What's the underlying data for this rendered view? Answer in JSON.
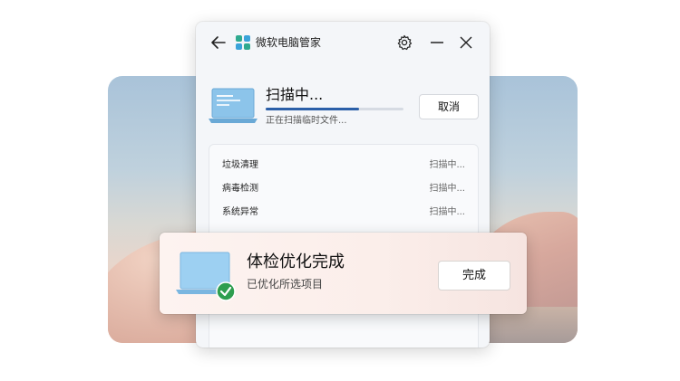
{
  "app": {
    "title": "微软电脑管家"
  },
  "scan": {
    "title": "扫描中...",
    "subtitle": "正在扫描临时文件...",
    "progress_fraction": 0.68,
    "cancel_label": "取消"
  },
  "scan_items": [
    {
      "label": "垃圾清理",
      "status": "扫描中..."
    },
    {
      "label": "病毒检测",
      "status": "扫描中..."
    },
    {
      "label": "系统异常",
      "status": "扫描中..."
    }
  ],
  "completion": {
    "title": "体检优化完成",
    "subtitle": "已优化所选项目",
    "done_label": "完成"
  },
  "icons": {
    "back": "back-arrow-icon",
    "logo": "pc-manager-logo",
    "settings": "gear-icon",
    "minimize": "minimize-icon",
    "close": "close-icon",
    "check": "check-icon"
  },
  "colors": {
    "accent": "#2b5fa8",
    "check_green": "#2e9e4f",
    "logo_green": "#2faa8f"
  }
}
